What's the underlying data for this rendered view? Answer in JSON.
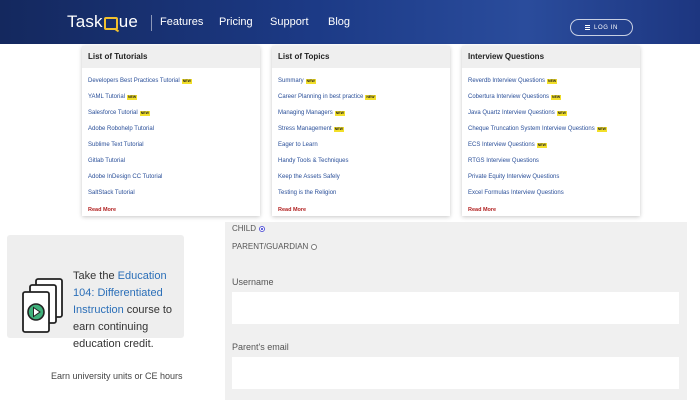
{
  "header": {
    "logo_text_a": "Task",
    "logo_text_b": "ue",
    "nav": [
      "Features",
      "Pricing",
      "Support",
      "Blog"
    ],
    "login_label": "LOG IN"
  },
  "dropdown": {
    "columns": [
      {
        "title": "List of Tutorials",
        "items": [
          {
            "label": "Developers Best Practices Tutorial",
            "badge": "NEW"
          },
          {
            "label": "YAML Tutorial",
            "badge": "NEW"
          },
          {
            "label": "Salesforce Tutorial",
            "badge": "NEW"
          },
          {
            "label": "Adobe Robohelp Tutorial",
            "badge": ""
          },
          {
            "label": "Sublime Text Tutorial",
            "badge": ""
          },
          {
            "label": "Gitlab Tutorial",
            "badge": ""
          },
          {
            "label": "Adobe InDesign CC Tutorial",
            "badge": ""
          },
          {
            "label": "SaltStack Tutorial",
            "badge": ""
          }
        ],
        "read_more": "Read More"
      },
      {
        "title": "List of Topics",
        "items": [
          {
            "label": "Summary",
            "badge": "NEW"
          },
          {
            "label": "Career Planning in best practice",
            "badge": "NEW"
          },
          {
            "label": "Managing Managers",
            "badge": "NEW"
          },
          {
            "label": "Stress Management",
            "badge": "NEW"
          },
          {
            "label": "Eager to Learn",
            "badge": ""
          },
          {
            "label": "Handy Tools & Techniques",
            "badge": ""
          },
          {
            "label": "Keep the Assets Safely",
            "badge": ""
          },
          {
            "label": "Testing is the Religion",
            "badge": ""
          }
        ],
        "read_more": "Read More"
      },
      {
        "title": "Interview Questions",
        "items": [
          {
            "label": "Reverdb Interview Questions",
            "badge": "NEW"
          },
          {
            "label": "Cobertura Interview Questions",
            "badge": "NEW"
          },
          {
            "label": "Java Quartz Interview Questions",
            "badge": "NEW"
          },
          {
            "label": "Cheque Truncation System Interview Questions",
            "badge": "NEW"
          },
          {
            "label": "ECS Interview Questions",
            "badge": "NEW"
          },
          {
            "label": "RTGS Interview Questions",
            "badge": ""
          },
          {
            "label": "Private Equity Interview Questions",
            "badge": ""
          },
          {
            "label": "Excel Formulas Interview Questions",
            "badge": ""
          }
        ],
        "read_more": "Read More"
      }
    ]
  },
  "promo": {
    "prefix": "Take the ",
    "course_link": "Education 104: Differentiated Instruction",
    "suffix": " course to earn continuing education credit.",
    "earn_text": "Earn university units or CE hours"
  },
  "form": {
    "radio_child": "CHILD",
    "radio_parent": "PARENT/GUARDIAN",
    "selected_role": "CHILD",
    "username_label": "Username",
    "username_value": "",
    "email_label": "Parent's email",
    "email_value": ""
  },
  "colors": {
    "header_bg": "#1c3a86",
    "logo_accent": "#f2c12e",
    "link": "#2a4f99",
    "read_more": "#b12020",
    "badge_bg": "#f2df2a"
  }
}
